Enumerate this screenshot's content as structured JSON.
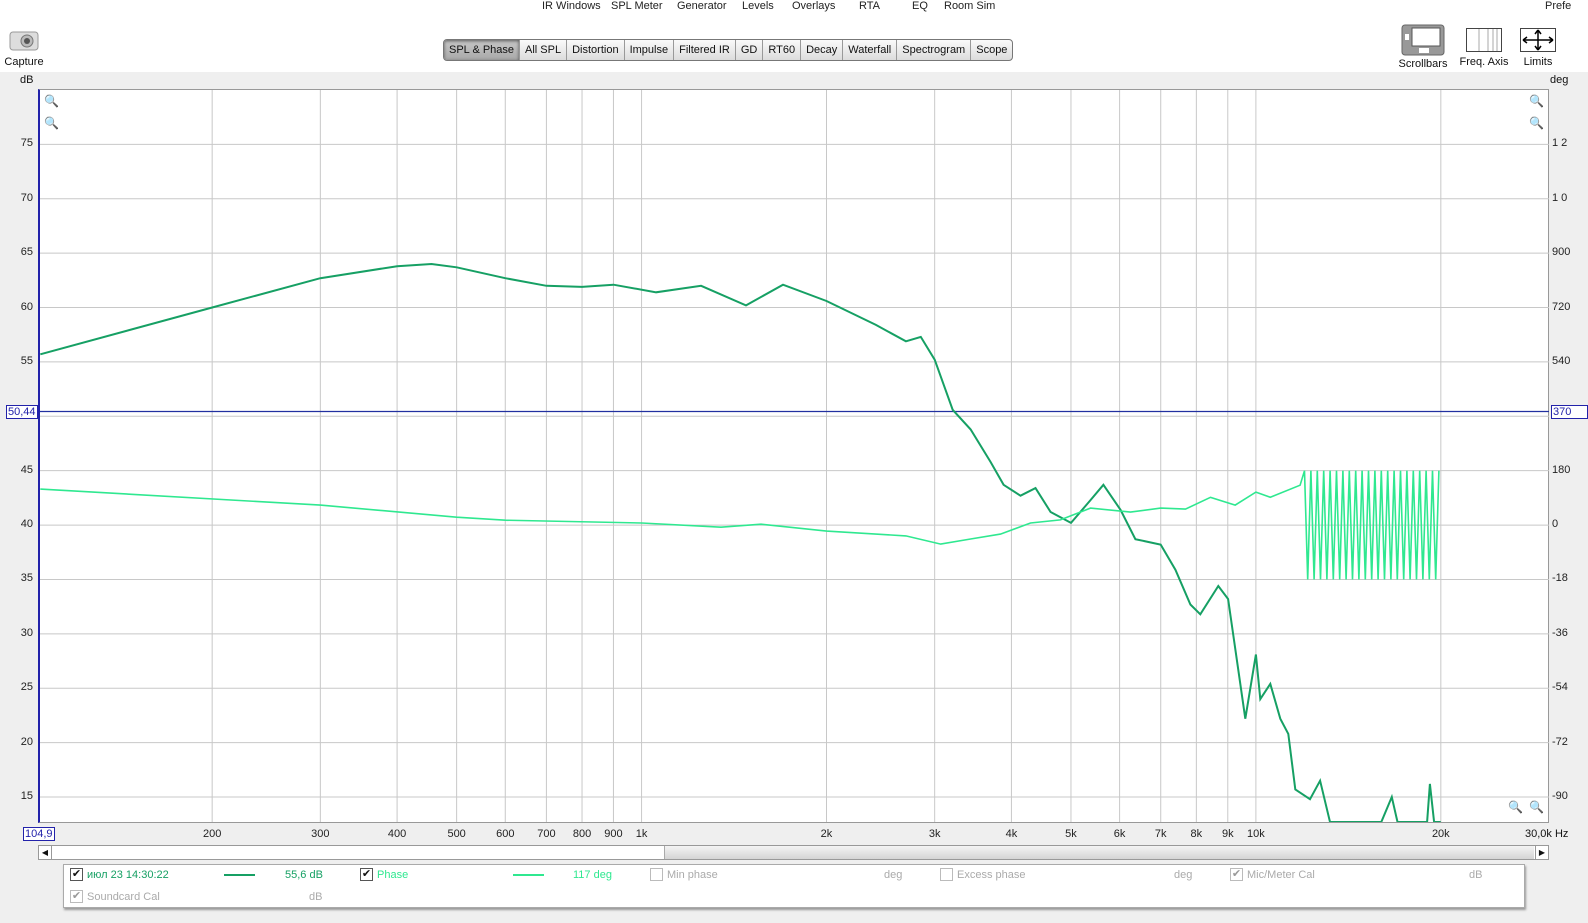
{
  "top_menu": [
    "IR Windows",
    "SPL Meter",
    "Generator",
    "Levels",
    "Overlays",
    "RTA",
    "EQ",
    "Room Sim",
    "Prefe"
  ],
  "capture_label": "Capture",
  "tabs": [
    "SPL & Phase",
    "All SPL",
    "Distortion",
    "Impulse",
    "Filtered IR",
    "GD",
    "RT60",
    "Decay",
    "Waterfall",
    "Spectrogram",
    "Scope"
  ],
  "active_tab": "SPL & Phase",
  "tools": {
    "scrollbars": "Scrollbars",
    "freq_axis": "Freq. Axis",
    "limits": "Limits"
  },
  "axis": {
    "left_unit": "dB",
    "right_unit": "deg",
    "x_unit": "Hz"
  },
  "cursor": {
    "db_label": "50,44",
    "deg_label": "370",
    "freq_label": "104,9"
  },
  "legend": {
    "measurement": {
      "label": "июл 23 14:30:22",
      "value": "55,6 dB",
      "checked": true
    },
    "phase": {
      "label": "Phase",
      "value": "117 deg",
      "checked": true
    },
    "min_phase": {
      "label": "Min phase",
      "value": "deg",
      "checked": false
    },
    "excess_phase": {
      "label": "Excess phase",
      "value": "deg",
      "checked": false
    },
    "mic_cal": {
      "label": "Mic/Meter Cal",
      "value": "dB",
      "checked": true
    },
    "soundcard_cal": {
      "label": "Soundcard Cal",
      "value": "dB",
      "checked": true
    }
  },
  "chart_data": {
    "type": "line",
    "xscale": "log",
    "xlim": [
      104.9,
      30000
    ],
    "ylim": [
      12.7,
      80
    ],
    "y2lim": [
      -1000,
      1650
    ],
    "x_ticks": [
      {
        "v": 200,
        "l": "200"
      },
      {
        "v": 300,
        "l": "300"
      },
      {
        "v": 400,
        "l": "400"
      },
      {
        "v": 500,
        "l": "500"
      },
      {
        "v": 600,
        "l": "600"
      },
      {
        "v": 700,
        "l": "700"
      },
      {
        "v": 800,
        "l": "800"
      },
      {
        "v": 900,
        "l": "900"
      },
      {
        "v": 1000,
        "l": "1k"
      },
      {
        "v": 2000,
        "l": "2k"
      },
      {
        "v": 3000,
        "l": "3k"
      },
      {
        "v": 4000,
        "l": "4k"
      },
      {
        "v": 5000,
        "l": "5k"
      },
      {
        "v": 6000,
        "l": "6k"
      },
      {
        "v": 7000,
        "l": "7k"
      },
      {
        "v": 8000,
        "l": "8k"
      },
      {
        "v": 9000,
        "l": "9k"
      },
      {
        "v": 10000,
        "l": "10k"
      },
      {
        "v": 20000,
        "l": "20k"
      }
    ],
    "x_end_label": "30,0k Hz",
    "y_ticks": [
      75,
      70,
      65,
      60,
      55,
      50,
      45,
      40,
      35,
      30,
      25,
      20,
      15
    ],
    "y2_ticks": [
      "1 2",
      "1 0",
      "900",
      "720",
      "540",
      "360",
      "180",
      "0",
      "-18",
      "-36",
      "-54",
      "-72",
      "-90"
    ],
    "series": [
      {
        "name": "SPL",
        "color": "#16a064",
        "axis": "dB",
        "points": [
          [
            105,
            55.7
          ],
          [
            200,
            60
          ],
          [
            300,
            62.7
          ],
          [
            400,
            63.8
          ],
          [
            455,
            64
          ],
          [
            500,
            63.7
          ],
          [
            600,
            62.7
          ],
          [
            700,
            62
          ],
          [
            800,
            61.9
          ],
          [
            900,
            62.1
          ],
          [
            1056,
            61.4
          ],
          [
            1250,
            62
          ],
          [
            1479,
            60.2
          ],
          [
            1699,
            62.1
          ],
          [
            2000,
            60.6
          ],
          [
            2407,
            58.4
          ],
          [
            2693,
            56.9
          ],
          [
            2848,
            57.3
          ],
          [
            3000,
            55.2
          ],
          [
            3210,
            50.6
          ],
          [
            3433,
            48.8
          ],
          [
            3700,
            45.8
          ],
          [
            3885,
            43.7
          ],
          [
            4139,
            42.7
          ],
          [
            4378,
            43.4
          ],
          [
            4632,
            41.2
          ],
          [
            5000,
            40.2
          ],
          [
            5380,
            42.3
          ],
          [
            5647,
            43.7
          ],
          [
            6020,
            41.4
          ],
          [
            6367,
            38.7
          ],
          [
            7000,
            38.2
          ],
          [
            7395,
            35.9
          ],
          [
            7822,
            32.7
          ],
          [
            8119,
            31.8
          ],
          [
            8685,
            34.4
          ],
          [
            9011,
            33.2
          ],
          [
            9610,
            22.2
          ],
          [
            10000,
            28.1
          ],
          [
            10165,
            24
          ],
          [
            10553,
            25.4
          ],
          [
            10960,
            22.2
          ],
          [
            11290,
            20.8
          ],
          [
            11590,
            15.7
          ],
          [
            12250,
            14.8
          ],
          [
            12720,
            16.5
          ],
          [
            13200,
            12.7
          ],
          [
            16000,
            12.7
          ],
          [
            16640,
            15
          ],
          [
            17000,
            12.7
          ],
          [
            19000,
            12.7
          ],
          [
            19200,
            16.2
          ],
          [
            19500,
            12.7
          ],
          [
            20000,
            12.7
          ]
        ]
      },
      {
        "name": "Phase",
        "color": "#2fe890",
        "axis": "deg",
        "points": [
          [
            105,
            119
          ],
          [
            300,
            66
          ],
          [
            500,
            26
          ],
          [
            600,
            16
          ],
          [
            1000,
            7
          ],
          [
            1347,
            -7
          ],
          [
            1565,
            3
          ],
          [
            2000,
            -20
          ],
          [
            2693,
            -36
          ],
          [
            3068,
            -63
          ],
          [
            3433,
            -46
          ],
          [
            3840,
            -30
          ],
          [
            4297,
            7
          ],
          [
            4806,
            17
          ],
          [
            5380,
            56
          ],
          [
            6250,
            43
          ],
          [
            7000,
            56
          ],
          [
            7680,
            53
          ],
          [
            8435,
            92
          ],
          [
            9255,
            66
          ],
          [
            10000,
            109
          ],
          [
            10553,
            92
          ],
          [
            11800,
            132
          ]
        ],
        "wrap": {
          "from_hz": 12000,
          "to_hz": 20000,
          "min": -180,
          "max": 180
        }
      }
    ]
  }
}
